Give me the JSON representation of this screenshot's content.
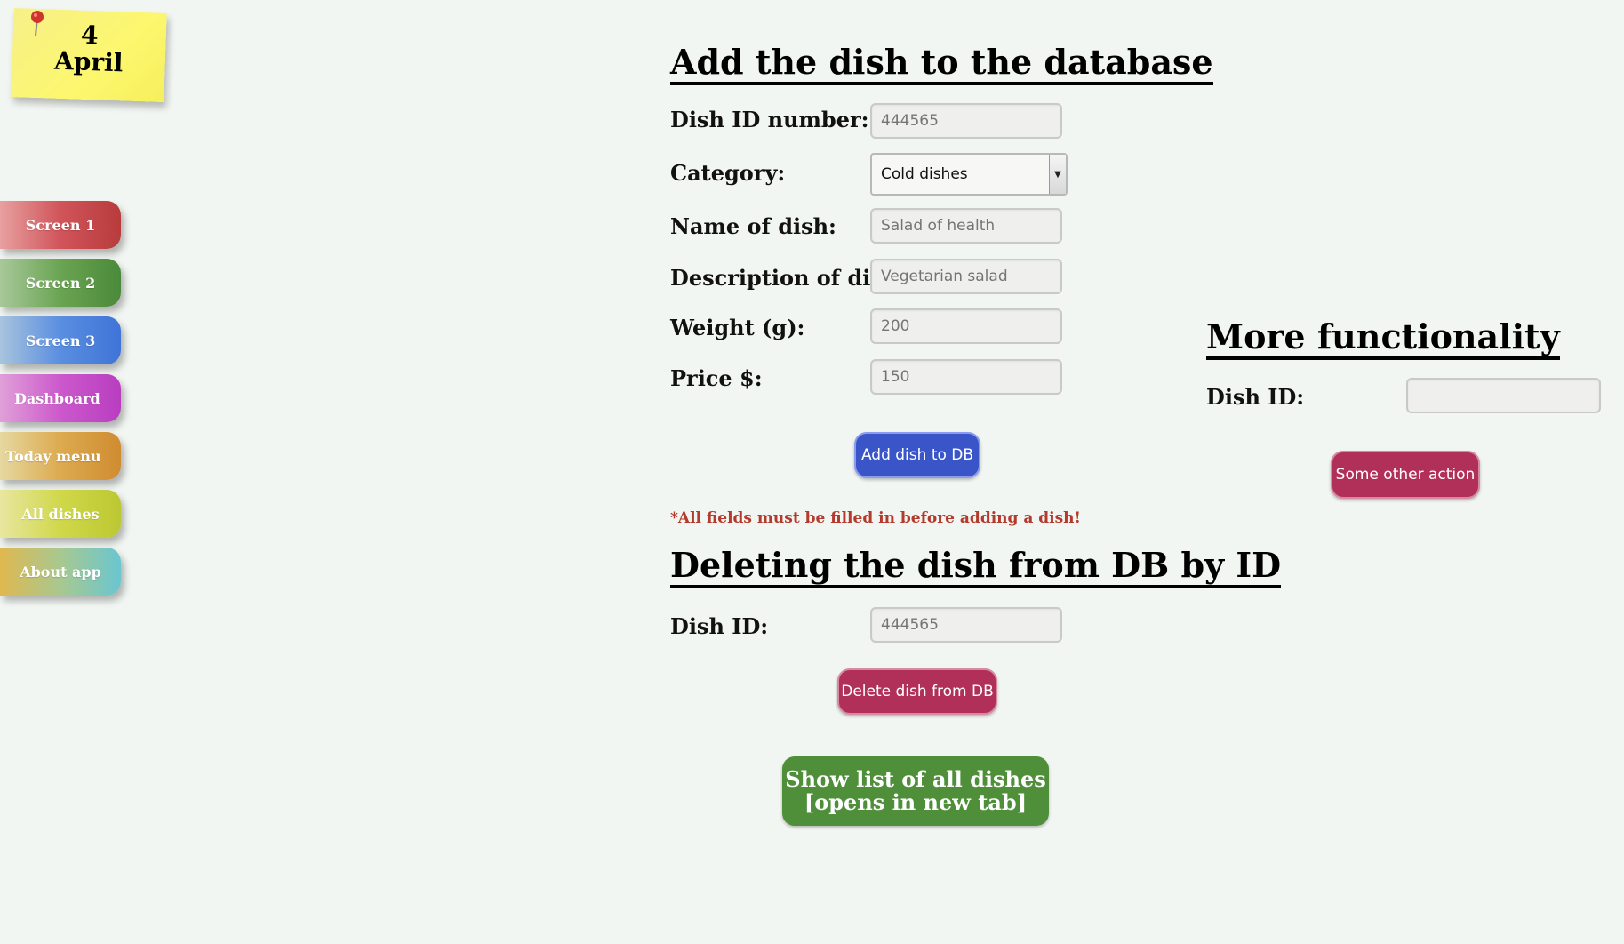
{
  "note": {
    "day": "4",
    "month": "April"
  },
  "nav": {
    "items": [
      {
        "label": "Screen 1",
        "color": "#c9464a"
      },
      {
        "label": "Screen 2",
        "color": "#5e9a48"
      },
      {
        "label": "Screen 3",
        "color": "#4a7ed8"
      },
      {
        "label": "Dashboard",
        "color": "#c449c4"
      },
      {
        "label": "Today menu",
        "color": "#d89a3a"
      },
      {
        "label": "All dishes",
        "color": "#c9d43a"
      },
      {
        "label": "About app",
        "color": "#6cc7c7"
      }
    ]
  },
  "add_section": {
    "title": "Add the dish to the database",
    "fields": {
      "dish_id": {
        "label": "Dish ID number:",
        "placeholder": "444565"
      },
      "category": {
        "label": "Category:",
        "value": "Cold dishes"
      },
      "name": {
        "label": "Name of dish:",
        "placeholder": "Salad of health"
      },
      "description": {
        "label": "Description of dish:",
        "placeholder": "Vegetarian salad"
      },
      "weight": {
        "label": "Weight (g):",
        "placeholder": "200"
      },
      "price": {
        "label": "Price $:",
        "placeholder": "150"
      }
    },
    "add_button": "Add dish to DB",
    "warning": "*All fields must be filled in before adding a dish!"
  },
  "delete_section": {
    "title": "Deleting the dish from DB by ID",
    "dish_id_label": "Dish ID:",
    "dish_id_placeholder": "444565",
    "delete_button": "Delete dish from DB"
  },
  "show_list_button": {
    "line1": "Show list of all dishes",
    "line2": "[opens in new tab]"
  },
  "more_section": {
    "title": "More functionality",
    "dish_id_label": "Dish ID:",
    "dish_id_placeholder": "",
    "action_button": "Some other action"
  }
}
